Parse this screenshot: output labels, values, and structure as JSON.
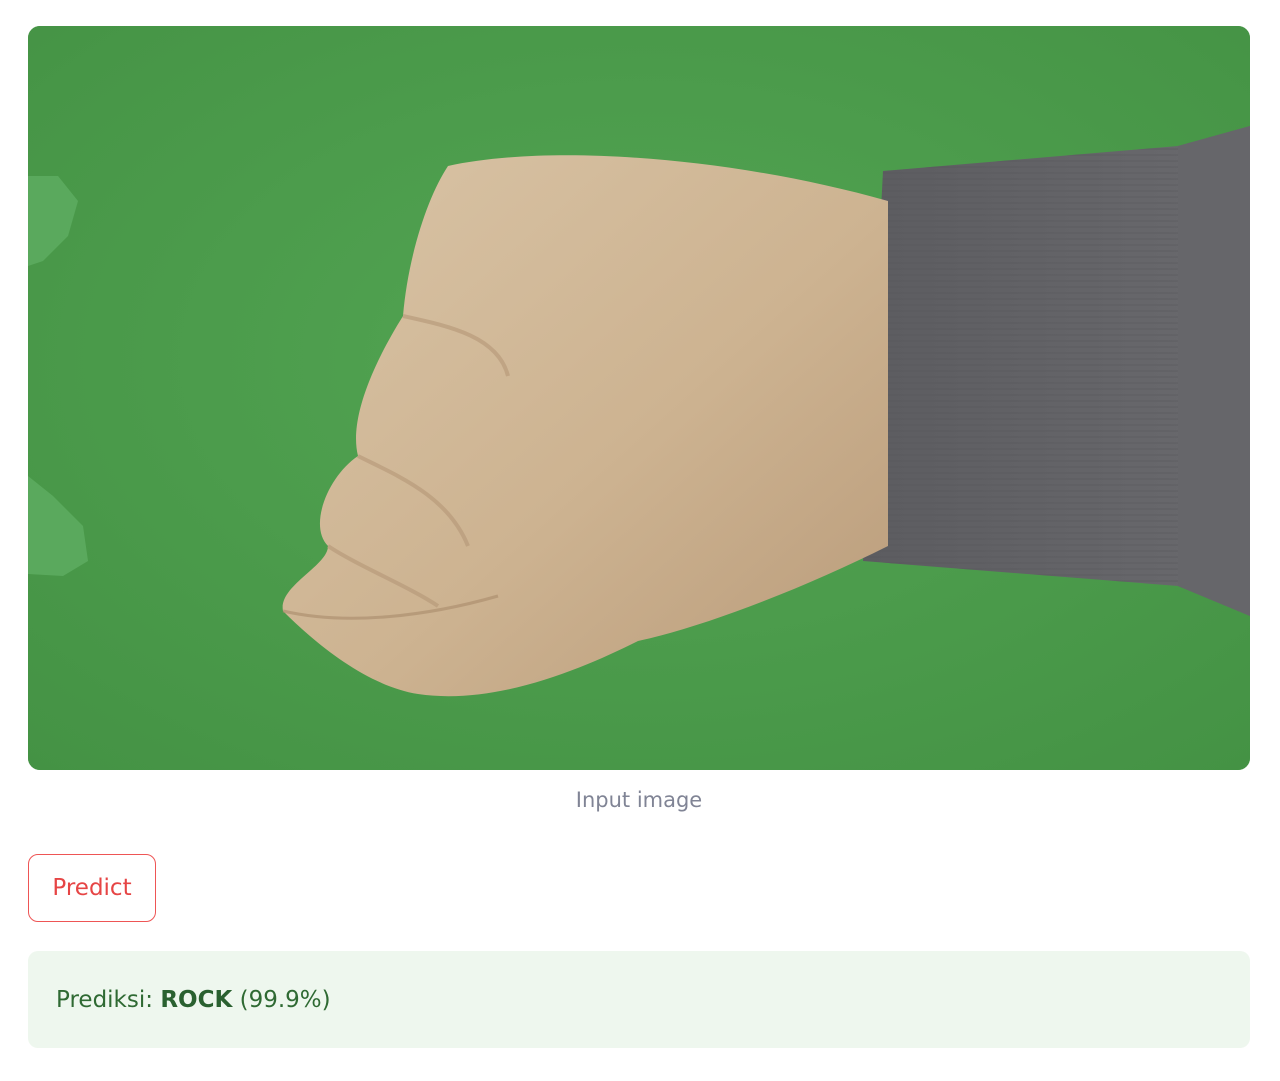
{
  "image": {
    "caption": "Input image",
    "background_color": "#4a9a49"
  },
  "actions": {
    "predict_label": "Predict"
  },
  "result": {
    "prefix": "Prediksi:",
    "label": "ROCK",
    "confidence": "(99.9%)",
    "background_color": "#eef7ee",
    "text_color": "#2f6a33"
  }
}
